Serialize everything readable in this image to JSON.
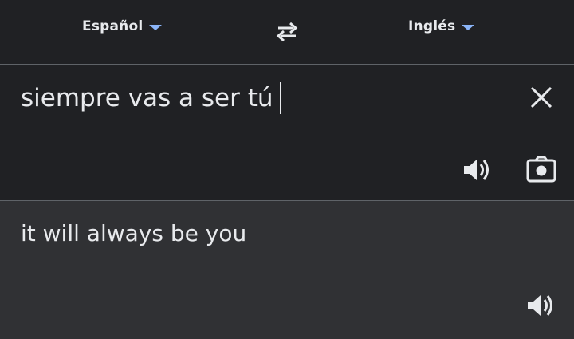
{
  "language_bar": {
    "source_language": "Español",
    "target_language": "Inglés",
    "caret_color": "#8ab4f8"
  },
  "input": {
    "text": "siempre vas a ser tú"
  },
  "output": {
    "text": "it will always be you"
  },
  "icons": {
    "swap": "swap-arrows-icon",
    "clear": "close-icon",
    "listen_source": "speaker-icon",
    "camera": "camera-icon",
    "listen_target": "speaker-icon"
  },
  "colors": {
    "background": "#202124",
    "output_background": "#303134",
    "divider": "#5f6368",
    "text": "#e8eaed"
  }
}
